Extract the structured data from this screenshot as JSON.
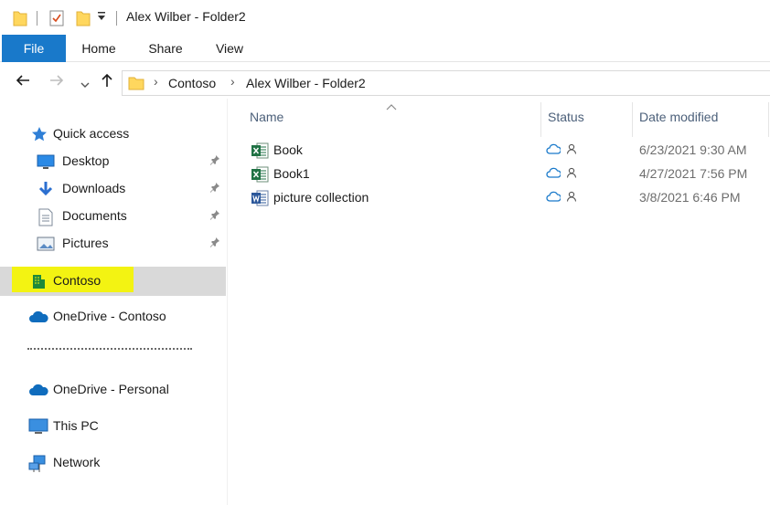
{
  "window": {
    "title": "Alex Wilber - Folder2"
  },
  "ribbon": {
    "tabs": [
      "File",
      "Home",
      "Share",
      "View"
    ]
  },
  "address": {
    "crumbs": [
      "Contoso",
      "Alex Wilber - Folder2"
    ]
  },
  "navpane": {
    "quick_access": "Quick access",
    "quick_items": [
      {
        "label": "Desktop",
        "icon": "desktop-icon",
        "pinned": true
      },
      {
        "label": "Downloads",
        "icon": "downloads-icon",
        "pinned": true
      },
      {
        "label": "Documents",
        "icon": "documents-icon",
        "pinned": true
      },
      {
        "label": "Pictures",
        "icon": "pictures-icon",
        "pinned": true
      }
    ],
    "contoso": "Contoso",
    "onedrive_contoso": "OneDrive - Contoso",
    "onedrive_personal": "OneDrive - Personal",
    "this_pc": "This PC",
    "network": "Network"
  },
  "columns": {
    "name": "Name",
    "status": "Status",
    "date_modified": "Date modified"
  },
  "files": [
    {
      "name": "Book",
      "type": "excel",
      "date": "6/23/2021 9:30 AM"
    },
    {
      "name": "Book1",
      "type": "excel",
      "date": "4/27/2021 7:56 PM"
    },
    {
      "name": "picture collection",
      "type": "word",
      "date": "3/8/2021 6:46 PM"
    }
  ],
  "colors": {
    "file_tab": "#1979ca",
    "highlight": "#f3f312",
    "selected_row": "#d9d9d9",
    "status_icon": "#1979ca",
    "excel": "#1f7244",
    "word": "#2b579a"
  }
}
